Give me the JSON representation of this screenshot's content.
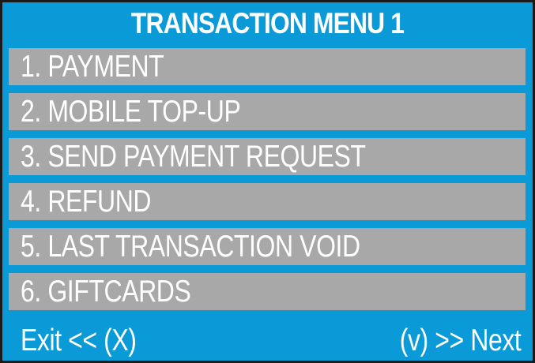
{
  "screen": {
    "title": "TRANSACTION MENU 1"
  },
  "menu": {
    "items": [
      {
        "label": "1. PAYMENT"
      },
      {
        "label": "2. MOBILE TOP-UP"
      },
      {
        "label": "3. SEND PAYMENT REQUEST"
      },
      {
        "label": "4. REFUND"
      },
      {
        "label": "5. LAST TRANSACTION VOID"
      },
      {
        "label": "6. GIFTCARDS"
      }
    ]
  },
  "footer": {
    "exit_label": "Exit << (X)",
    "next_label": "(v) >> Next"
  },
  "colors": {
    "background_blue": "#0a9ad8",
    "item_gray": "#a8a8a8",
    "text": "#ffffff",
    "border": "#1a1a1a"
  }
}
